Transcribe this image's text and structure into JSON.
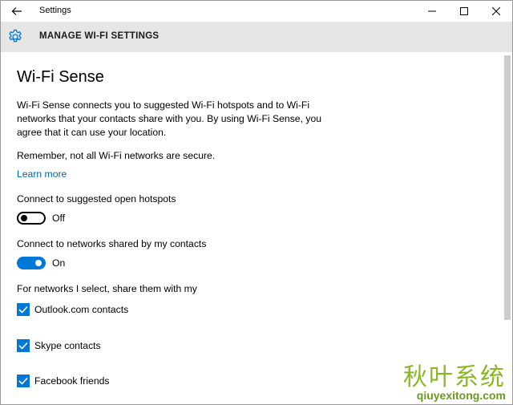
{
  "window": {
    "title": "Settings"
  },
  "header": {
    "title": "MANAGE WI-FI SETTINGS",
    "icon": "gear-icon"
  },
  "main": {
    "heading": "Wi-Fi Sense",
    "description": "Wi-Fi Sense connects you to suggested Wi-Fi hotspots and to Wi-Fi networks that your contacts share with you. By using Wi-Fi Sense, you agree that it can use your location.",
    "remember": "Remember, not all Wi-Fi networks are secure.",
    "learn_more": "Learn more",
    "settings": [
      {
        "label": "Connect to suggested open hotspots",
        "state": "Off",
        "on": false
      },
      {
        "label": "Connect to networks shared by my contacts",
        "state": "On",
        "on": true
      }
    ],
    "share_label": "For networks I select, share them with my",
    "share_options": [
      {
        "label": "Outlook.com contacts",
        "checked": true
      },
      {
        "label": "Skype contacts",
        "checked": true
      },
      {
        "label": "Facebook friends",
        "checked": true
      }
    ]
  },
  "watermark": {
    "text": "秋叶系统",
    "url": "qiuyexitong.com"
  },
  "colors": {
    "accent": "#0078d7",
    "link": "#0063b1",
    "header_bg": "#e6e6e6"
  }
}
